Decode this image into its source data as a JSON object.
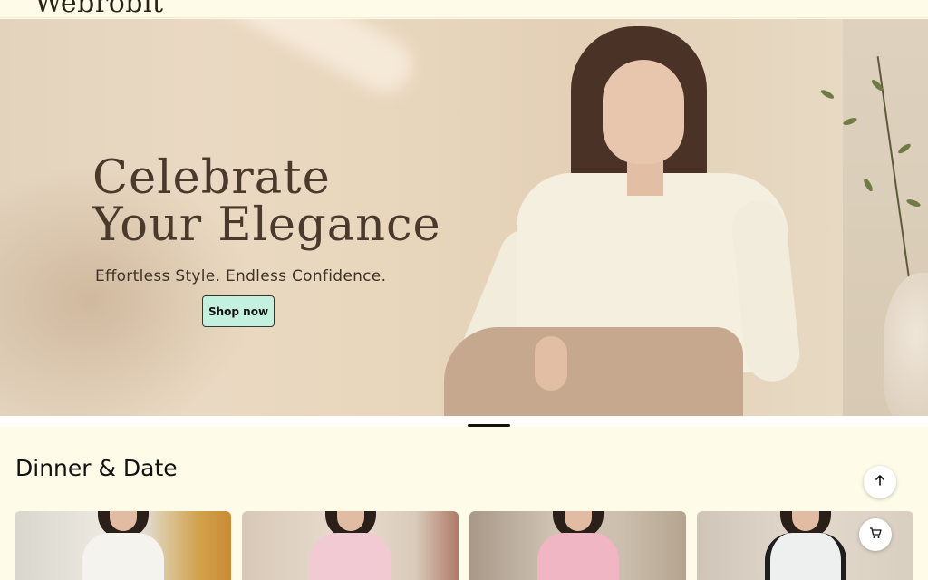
{
  "header": {
    "logo": "Webrobit"
  },
  "hero": {
    "title_line1": "Celebrate",
    "title_line2": "Your Elegance",
    "subtitle": "Effortless Style. Endless Confidence.",
    "cta_label": "Shop now",
    "carousel": {
      "active_index": 0
    }
  },
  "section": {
    "title": "Dinner & Date"
  },
  "products": [
    {
      "image": "white-vest-dress"
    },
    {
      "image": "pink-off-shoulder-dress"
    },
    {
      "image": "pink-square-neck-dress"
    },
    {
      "image": "white-black-trim-dress"
    }
  ],
  "icons": {
    "scroll_top": "arrow-up-icon",
    "cart": "cart-icon"
  },
  "colors": {
    "background": "#fefce9",
    "cta_background": "#c4f0df",
    "hero_text": "#4a3a2c"
  }
}
